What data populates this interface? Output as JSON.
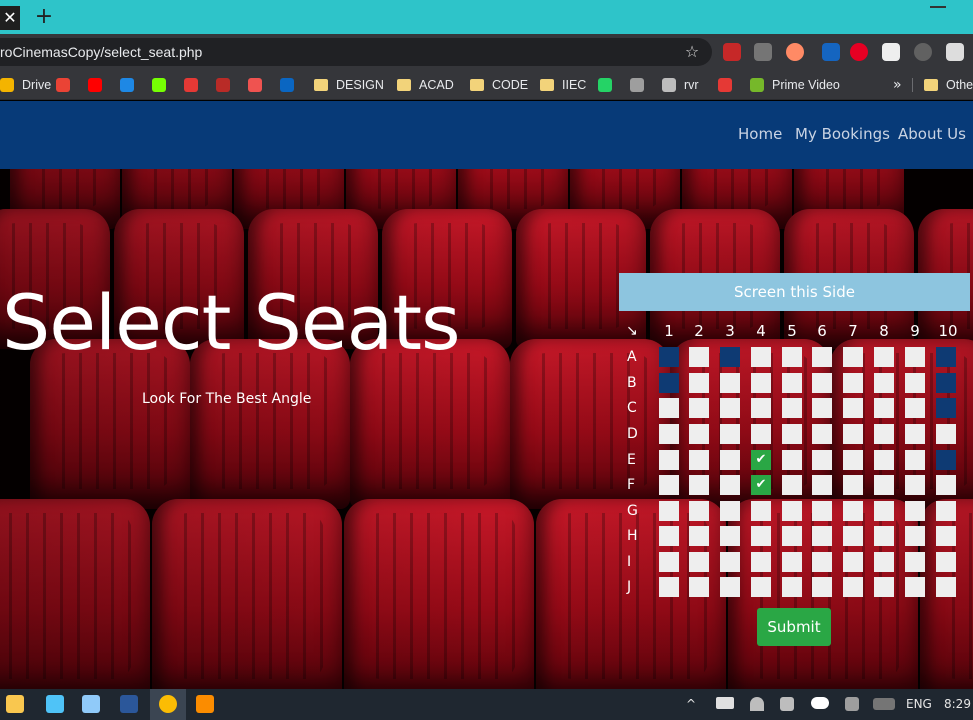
{
  "browser": {
    "tab_close_glyph": "✕",
    "new_tab_glyph": "+",
    "url": "roCinemasCopy/select_seat.php",
    "star_glyph": "☆",
    "bookmarks": [
      {
        "label": "Drive",
        "icon": "drive-icon",
        "color": "#f4b400"
      },
      {
        "label": "",
        "icon": "gmail-icon",
        "color": "#ea4335"
      },
      {
        "label": "",
        "icon": "youtube-icon",
        "color": "#ff0000"
      },
      {
        "label": "",
        "icon": "tbf-icon",
        "color": "#1e88e5"
      },
      {
        "label": "",
        "icon": "graph-icon",
        "color": "#76ff03"
      },
      {
        "label": "",
        "icon": "bookmark-red-icon",
        "color": "#e53935"
      },
      {
        "label": "",
        "icon": "quora-icon",
        "color": "#b92b27"
      },
      {
        "label": "",
        "icon": "g-icon",
        "color": "#ef5350"
      },
      {
        "label": "",
        "icon": "linkedin-icon",
        "color": "#0a66c2"
      },
      {
        "label": "DESIGN",
        "icon": "folder-icon"
      },
      {
        "label": "ACAD",
        "icon": "folder-icon"
      },
      {
        "label": "CODE",
        "icon": "folder-icon"
      },
      {
        "label": "IIEC",
        "icon": "folder-icon"
      },
      {
        "label": "",
        "icon": "whatsapp-icon",
        "color": "#25d366"
      },
      {
        "label": "",
        "icon": "bookmark-gray-icon",
        "color": "#9e9e9e"
      },
      {
        "label": "rvr",
        "icon": "rvr-icon",
        "color": "#bdbdbd"
      },
      {
        "label": "",
        "icon": "speed-icon",
        "color": "#e53935"
      },
      {
        "label": "Prime Video",
        "icon": "prime-video-icon",
        "color": "#76b82a"
      }
    ],
    "more_glyph": "»",
    "other_bookmarks": "Othe"
  },
  "nav": {
    "links": [
      "Home",
      "My Bookings",
      "About Us"
    ]
  },
  "hero": {
    "title": "Select Seats",
    "subtitle": "Look For The Best Angle"
  },
  "seat_map": {
    "screen_label": "Screen this Side",
    "corner_glyph": "↘",
    "columns": [
      "1",
      "2",
      "3",
      "4",
      "5",
      "6",
      "7",
      "8",
      "9",
      "10"
    ],
    "rows": [
      "A",
      "B",
      "C",
      "D",
      "E",
      "F",
      "G",
      "H",
      "I",
      "J"
    ],
    "booked": [
      "A1",
      "A3",
      "A10",
      "B1",
      "B10",
      "C10",
      "E10"
    ],
    "selected": [
      "E4",
      "F4"
    ],
    "check_glyph": "✔",
    "submit_label": "Submit",
    "colors": {
      "free": "#eeeeee",
      "booked": "#0e3a73",
      "selected": "#2aa745",
      "screen": "#8dc5df"
    }
  },
  "taskbar": {
    "lang": "ENG",
    "time": "8:29",
    "up_glyph": "^"
  },
  "colors": {
    "navbar": "#073a78",
    "tabstrip": "#2ec4c9",
    "accent": "#2aa745"
  }
}
